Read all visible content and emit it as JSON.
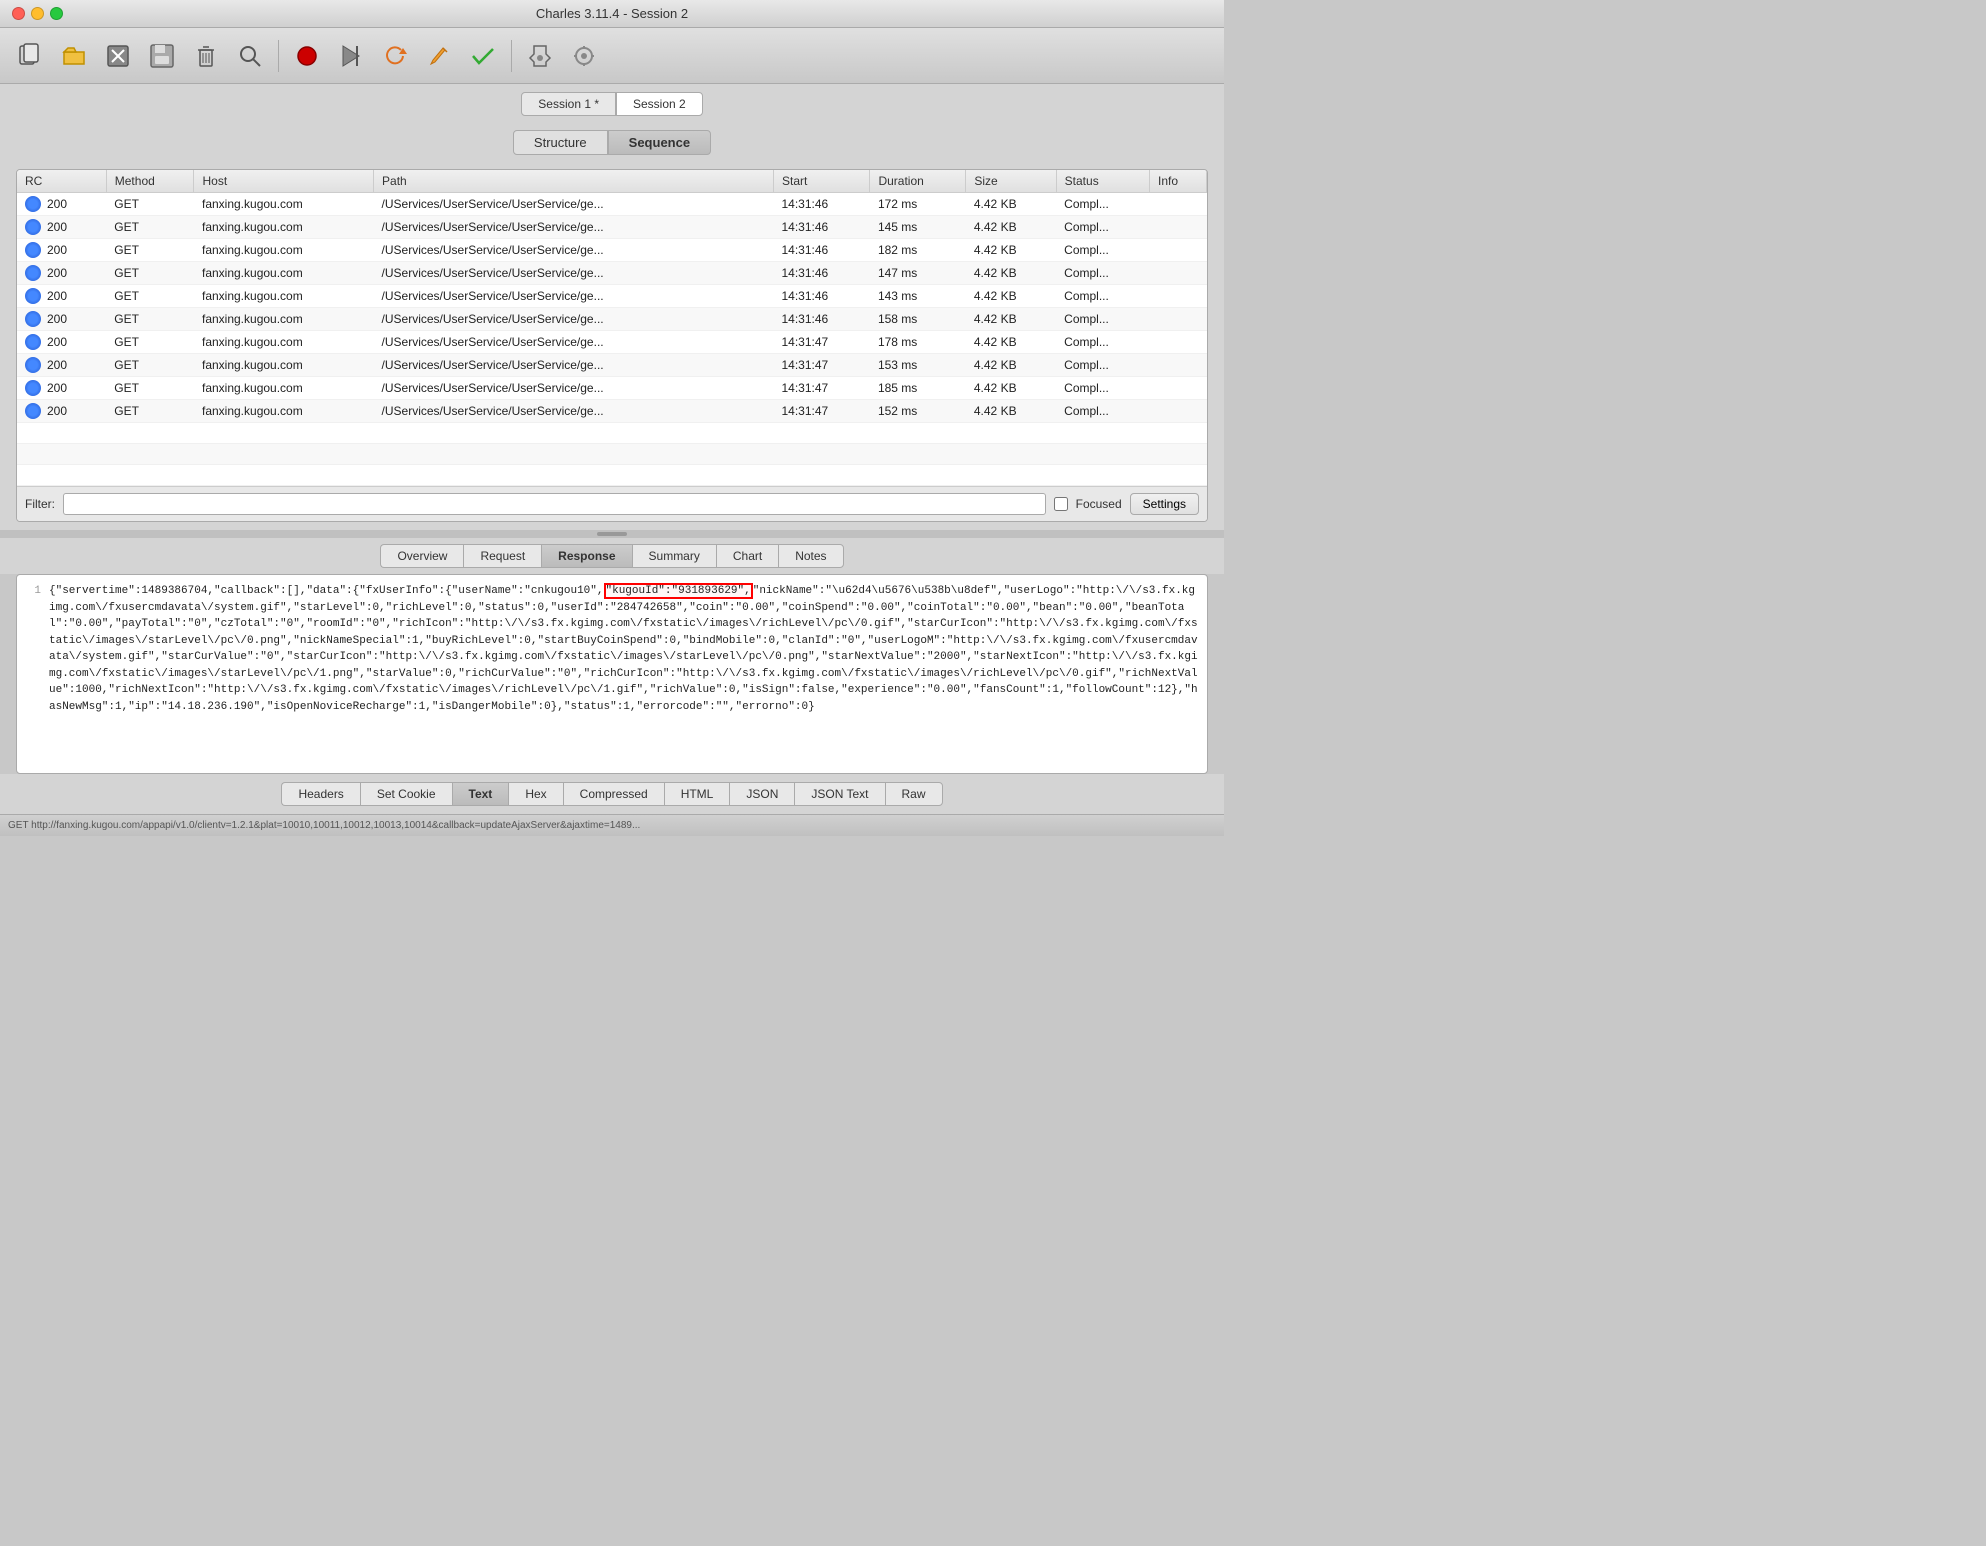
{
  "window": {
    "title": "Charles 3.11.4 - Session 2"
  },
  "window_controls": {
    "close": "close",
    "minimize": "minimize",
    "maximize": "maximize"
  },
  "toolbar": {
    "buttons": [
      {
        "name": "new-session",
        "icon": "🗂",
        "label": "New Session"
      },
      {
        "name": "open",
        "icon": "📂",
        "label": "Open"
      },
      {
        "name": "close",
        "icon": "🗄",
        "label": "Close"
      },
      {
        "name": "save",
        "icon": "💾",
        "label": "Save"
      },
      {
        "name": "trash",
        "icon": "🗑",
        "label": "Clear"
      },
      {
        "name": "find",
        "icon": "🔭",
        "label": "Find"
      },
      {
        "name": "record",
        "icon": "⏺",
        "label": "Record",
        "color": "red"
      },
      {
        "name": "tools",
        "icon": "🔧",
        "label": "Tools"
      },
      {
        "name": "throttle",
        "icon": "⏸",
        "label": "Throttle"
      },
      {
        "name": "refresh",
        "icon": "↺",
        "label": "Refresh"
      },
      {
        "name": "edit",
        "icon": "✏",
        "label": "Edit"
      },
      {
        "name": "check",
        "icon": "✔",
        "label": "Check"
      },
      {
        "name": "settings",
        "icon": "⚙",
        "label": "Settings"
      },
      {
        "name": "preferences",
        "icon": "🔧",
        "label": "Preferences"
      }
    ]
  },
  "session_tabs": [
    {
      "label": "Session 1 *",
      "active": false
    },
    {
      "label": "Session 2",
      "active": true
    }
  ],
  "view_tabs": [
    {
      "label": "Structure",
      "active": false
    },
    {
      "label": "Sequence",
      "active": true
    }
  ],
  "table": {
    "columns": [
      "RC",
      "Method",
      "Host",
      "Path",
      "Start",
      "Duration",
      "Size",
      "Status",
      "Info"
    ],
    "rows": [
      {
        "rc": "200",
        "method": "GET",
        "host": "fanxing.kugou.com",
        "path": "/UServices/UserService/UserService/ge...",
        "start": "14:31:46",
        "duration": "172 ms",
        "size": "4.42 KB",
        "status": "Compl...",
        "info": ""
      },
      {
        "rc": "200",
        "method": "GET",
        "host": "fanxing.kugou.com",
        "path": "/UServices/UserService/UserService/ge...",
        "start": "14:31:46",
        "duration": "145 ms",
        "size": "4.42 KB",
        "status": "Compl...",
        "info": ""
      },
      {
        "rc": "200",
        "method": "GET",
        "host": "fanxing.kugou.com",
        "path": "/UServices/UserService/UserService/ge...",
        "start": "14:31:46",
        "duration": "182 ms",
        "size": "4.42 KB",
        "status": "Compl...",
        "info": ""
      },
      {
        "rc": "200",
        "method": "GET",
        "host": "fanxing.kugou.com",
        "path": "/UServices/UserService/UserService/ge...",
        "start": "14:31:46",
        "duration": "147 ms",
        "size": "4.42 KB",
        "status": "Compl...",
        "info": ""
      },
      {
        "rc": "200",
        "method": "GET",
        "host": "fanxing.kugou.com",
        "path": "/UServices/UserService/UserService/ge...",
        "start": "14:31:46",
        "duration": "143 ms",
        "size": "4.42 KB",
        "status": "Compl...",
        "info": ""
      },
      {
        "rc": "200",
        "method": "GET",
        "host": "fanxing.kugou.com",
        "path": "/UServices/UserService/UserService/ge...",
        "start": "14:31:46",
        "duration": "158 ms",
        "size": "4.42 KB",
        "status": "Compl...",
        "info": ""
      },
      {
        "rc": "200",
        "method": "GET",
        "host": "fanxing.kugou.com",
        "path": "/UServices/UserService/UserService/ge...",
        "start": "14:31:47",
        "duration": "178 ms",
        "size": "4.42 KB",
        "status": "Compl...",
        "info": ""
      },
      {
        "rc": "200",
        "method": "GET",
        "host": "fanxing.kugou.com",
        "path": "/UServices/UserService/UserService/ge...",
        "start": "14:31:47",
        "duration": "153 ms",
        "size": "4.42 KB",
        "status": "Compl...",
        "info": ""
      },
      {
        "rc": "200",
        "method": "GET",
        "host": "fanxing.kugou.com",
        "path": "/UServices/UserService/UserService/ge...",
        "start": "14:31:47",
        "duration": "185 ms",
        "size": "4.42 KB",
        "status": "Compl...",
        "info": ""
      },
      {
        "rc": "200",
        "method": "GET",
        "host": "fanxing.kugou.com",
        "path": "/UServices/UserService/UserService/ge...",
        "start": "14:31:47",
        "duration": "152 ms",
        "size": "4.42 KB",
        "status": "Compl...",
        "info": ""
      }
    ]
  },
  "filter": {
    "label": "Filter:",
    "placeholder": "",
    "focused_label": "Focused",
    "settings_label": "Settings"
  },
  "detail_tabs": [
    {
      "label": "Overview",
      "active": false
    },
    {
      "label": "Request",
      "active": false
    },
    {
      "label": "Response",
      "active": true
    },
    {
      "label": "Summary",
      "active": false
    },
    {
      "label": "Chart",
      "active": false
    },
    {
      "label": "Notes",
      "active": false
    }
  ],
  "response": {
    "line_number": "1",
    "text": "{\"servertime\":1489386704,\"callback\":[],\"data\":{\"fxUserInfo\":{\"userName\":\"cnkugou10\",\"kugouId\":\"931893629\",\"nickName\":\"\\u62d4\\u5676\\u538b\\u8def\",\"userLogo\":\"http:\\/\\/s3.fx.kgimg.com\\/fxusercmdavata\\/system.gif\",\"starLevel\":0,\"richLevel\":0,\"status\":0,\"userId\":\"284742658\",\"coin\":\"0.00\",\"coinSpend\":\"0.00\",\"coinTotal\":\"0.00\",\"bean\":\"0.00\",\"beanTotal\":\"0.00\",\"payTotal\":\"0\",\"czTotal\":\"0\",\"roomId\":\"0\",\"richIcon\":\"http:\\/\\/s3.fx.kgimg.com\\/fxstatic\\/images\\/richLevel\\/pc\\/0.gif\",\"starCurIcon\":\"http:\\/\\/s3.fx.kgimg.com\\/fxstatic\\/images\\/starLevel\\/pc\\/0.png\",\"nickNameSpecial\":1,\"buyRichLevel\":0,\"startBuyCoinSpend\":0,\"bindMobile\":0,\"clanId\":\"0\",\"userLogoM\":\"http:\\/\\/s3.fx.kgimg.com\\/fxusercmdavata\\/system.gif\",\"starCurValue\":\"0\",\"starCurIcon\":\"http:\\/\\/s3.fx.kgimg.com\\/fxstatic\\/images\\/starLevel\\/pc\\/0.png\",\"starNextValue\":\"2000\",\"starNextIcon\":\"http:\\/\\/s3.fx.kgimg.com\\/fxstatic\\/images\\/starLevel\\/pc\\/1.png\",\"starValue\":0,\"richCurValue\":\"0\",\"richCurIcon\":\"http:\\/\\/s3.fx.kgimg.com\\/fxstatic\\/images\\/richLevel\\/pc\\/0.gif\",\"richNextValue\":1000,\"richNextIcon\":\"http:\\/\\/s3.fx.kgimg.com\\/fxstatic\\/images\\/richLevel\\/pc\\/1.gif\",\"richValue\":0,\"isSign\":false,\"experience\":\"0.00\",\"fansCount\":1,\"followCount\":12},\"hasNewMsg\":1,\"ip\":\"14.18.236.190\",\"isOpenNoviceRecharge\":1,\"isDangerMobile\":0},\"status\":1,\"errorcode\":\"\",\"errorno\":0}"
  },
  "bottom_tabs": [
    {
      "label": "Headers",
      "active": false
    },
    {
      "label": "Set Cookie",
      "active": false
    },
    {
      "label": "Text",
      "active": true
    },
    {
      "label": "Hex",
      "active": false
    },
    {
      "label": "Compressed",
      "active": false
    },
    {
      "label": "HTML",
      "active": false
    },
    {
      "label": "JSON",
      "active": false
    },
    {
      "label": "JSON Text",
      "active": false
    },
    {
      "label": "Raw",
      "active": false
    }
  ],
  "status_bar": {
    "text": "GET http://fanxing.kugou.com/appapi/v1.0/clientv=1.2.1&plat=10010,10011,10012,10013,10014&callback=updateAjaxServer&ajaxtime=1489..."
  }
}
